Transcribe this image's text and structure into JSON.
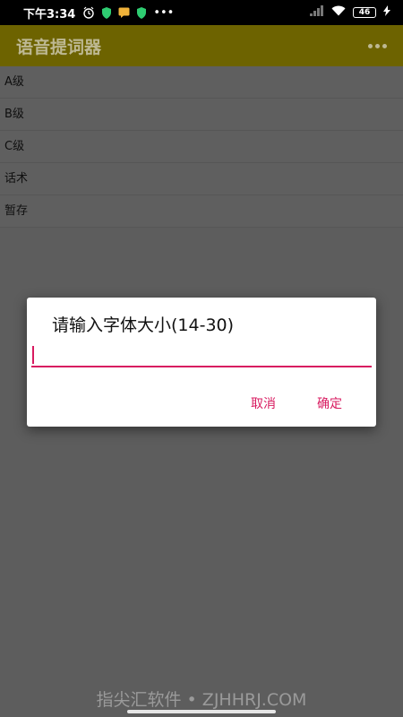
{
  "status_bar": {
    "time": "下午3:34",
    "dots": "•••",
    "signal_label": "4G",
    "battery": "46"
  },
  "app_bar": {
    "title": "语音提词器"
  },
  "list": {
    "items": [
      "A级",
      "B级",
      "C级",
      "话术",
      "暂存"
    ]
  },
  "dialog": {
    "title": "请输入字体大小(14-30)",
    "input_value": "",
    "input_placeholder": "",
    "cancel_label": "取消",
    "ok_label": "确定"
  },
  "watermark": "指尖汇软件 • ZJHHRJ.COM",
  "colors": {
    "accent": "#d81b60",
    "app_bar": "#6d6300",
    "dim_background": "#5d5d5d"
  }
}
